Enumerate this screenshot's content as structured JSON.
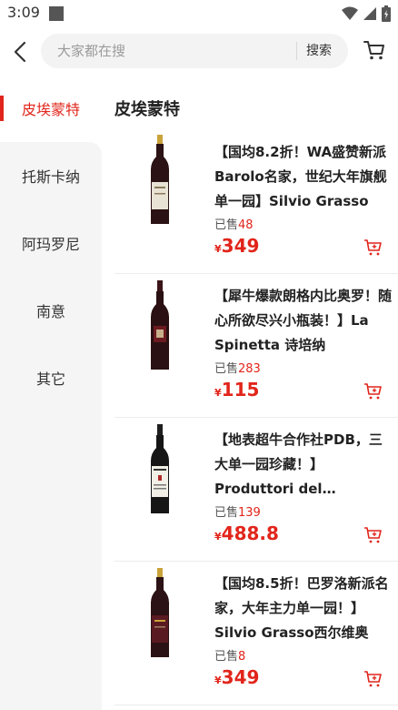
{
  "status_bar": {
    "time": "3:09"
  },
  "search": {
    "placeholder": "大家都在搜",
    "button_label": "搜索"
  },
  "sidebar": {
    "items": [
      {
        "label": "皮埃蒙特",
        "active": true
      },
      {
        "label": "托斯卡纳",
        "active": false
      },
      {
        "label": "阿玛罗尼",
        "active": false
      },
      {
        "label": "南意",
        "active": false
      },
      {
        "label": "其它",
        "active": false
      }
    ]
  },
  "section": {
    "title": "皮埃蒙特"
  },
  "products": [
    {
      "title": "【国均8.2折！WA盛赞新派Barolo名家，世纪大年旗舰单一园】Silvio Grasso",
      "sold_label": "已售",
      "sold": "48",
      "currency": "¥",
      "price": "349"
    },
    {
      "title": "【犀牛爆款朗格内比奥罗！随心所欲尽兴小瓶装！】La Spinetta 诗培纳",
      "sold_label": "已售",
      "sold": "283",
      "currency": "¥",
      "price": "115"
    },
    {
      "title": "【地表超牛合作社PDB，三大单一园珍藏！】Produttori del Barbaresco",
      "sold_label": "已售",
      "sold": "139",
      "currency": "¥",
      "price": "488.8"
    },
    {
      "title": "【国均8.5折！巴罗洛新派名家，大年主力单一园！】Silvio Grasso西尔维奥",
      "sold_label": "已售",
      "sold": "8",
      "currency": "¥",
      "price": "349"
    }
  ],
  "colors": {
    "accent": "#e1251b",
    "sidebar_bg": "#f5f5f5"
  },
  "icons": [
    "back-arrow-icon",
    "cart-icon",
    "add-to-cart-icon",
    "wifi-icon",
    "signal-icon",
    "battery-icon"
  ]
}
